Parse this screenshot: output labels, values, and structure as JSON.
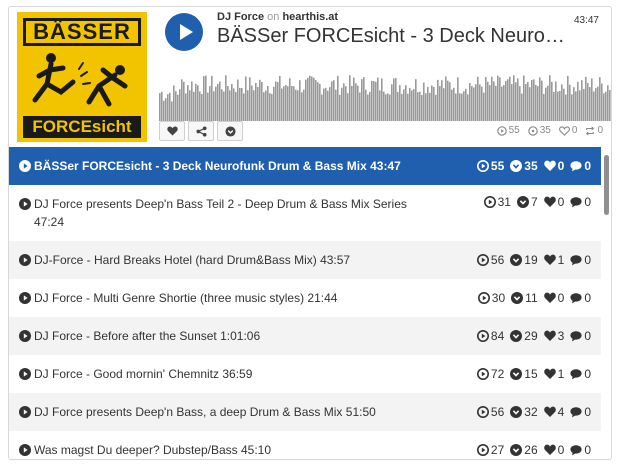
{
  "player": {
    "artist": "DJ Force",
    "on_text": "on",
    "site": "hearthis.at",
    "title": "BÄSSer FORCEsicht - 3 Deck Neurof...",
    "duration": "43:47",
    "cover": {
      "top_text": "BÄSSER",
      "bottom_text": "FORCEsicht"
    },
    "actions": [
      "heart-icon",
      "share-icon",
      "chevron-down-icon"
    ],
    "stats": {
      "plays": "55",
      "downloads": "35",
      "likes": "0",
      "reposts": "0"
    }
  },
  "colors": {
    "accent": "#1f5fae",
    "waveform": "#9a9a9a",
    "cover_yellow": "#f2c400"
  },
  "playlist": [
    {
      "title": "BÄSSer FORCEsicht - 3 Deck Neurofunk Drum & Bass Mix",
      "length": "43:47",
      "plays": "55",
      "downloads": "35",
      "likes": "0",
      "comments": "0"
    },
    {
      "title": "DJ Force presents Deep'n Bass Teil 2 - Deep Drum & Bass Mix Series",
      "length": "47:24",
      "plays": "31",
      "downloads": "7",
      "likes": "0",
      "comments": "0"
    },
    {
      "title": "DJ-Force - Hard Breaks Hotel (hard Drum&Bass Mix)",
      "length": "43:57",
      "plays": "56",
      "downloads": "19",
      "likes": "1",
      "comments": "0"
    },
    {
      "title": "DJ Force - Multi Genre Shortie (three music styles)",
      "length": "21:44",
      "plays": "30",
      "downloads": "11",
      "likes": "0",
      "comments": "0"
    },
    {
      "title": "DJ Force - Before after the Sunset",
      "length": "1:01:06",
      "plays": "84",
      "downloads": "29",
      "likes": "3",
      "comments": "0"
    },
    {
      "title": "DJ Force - Good mornin' Chemnitz",
      "length": "36:59",
      "plays": "72",
      "downloads": "15",
      "likes": "1",
      "comments": "0"
    },
    {
      "title": "DJ Force presents Deep'n Bass, a deep Drum & Bass Mix",
      "length": "51:50",
      "plays": "56",
      "downloads": "32",
      "likes": "4",
      "comments": "0"
    },
    {
      "title": "Was magst Du deeper? Dubstep/Bass",
      "length": "45:10",
      "plays": "27",
      "downloads": "26",
      "likes": "0",
      "comments": "0"
    }
  ]
}
